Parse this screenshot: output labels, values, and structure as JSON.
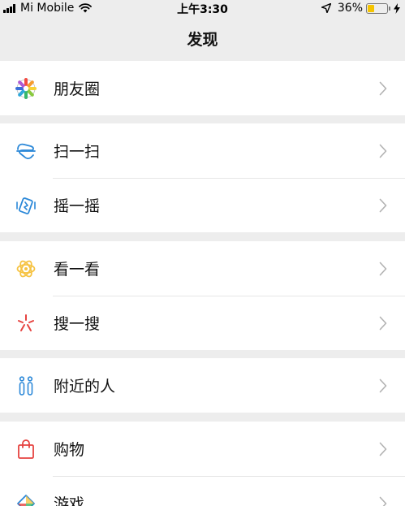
{
  "status_bar": {
    "carrier": "Mi Mobile",
    "time": "上午3:30",
    "battery": "36%",
    "battery_level": 0.36
  },
  "nav": {
    "title": "发现"
  },
  "menu": [
    {
      "label": "朋友圈",
      "icon": "moments-icon"
    },
    {
      "label": "扫一扫",
      "icon": "scan-icon"
    },
    {
      "label": "摇一摇",
      "icon": "shake-icon"
    },
    {
      "label": "看一看",
      "icon": "top-stories-icon"
    },
    {
      "label": "搜一搜",
      "icon": "search-icon"
    },
    {
      "label": "附近的人",
      "icon": "people-nearby-icon"
    },
    {
      "label": "购物",
      "icon": "shopping-bag-icon"
    },
    {
      "label": "游戏",
      "icon": "games-icon"
    }
  ],
  "colors": {
    "background": "#ededed",
    "scan_blue": "#2b88d8",
    "top_stories_yellow": "#f6c343",
    "search_red": "#e64340",
    "nearby_blue": "#2b88d8",
    "shopping_red": "#e64340"
  }
}
